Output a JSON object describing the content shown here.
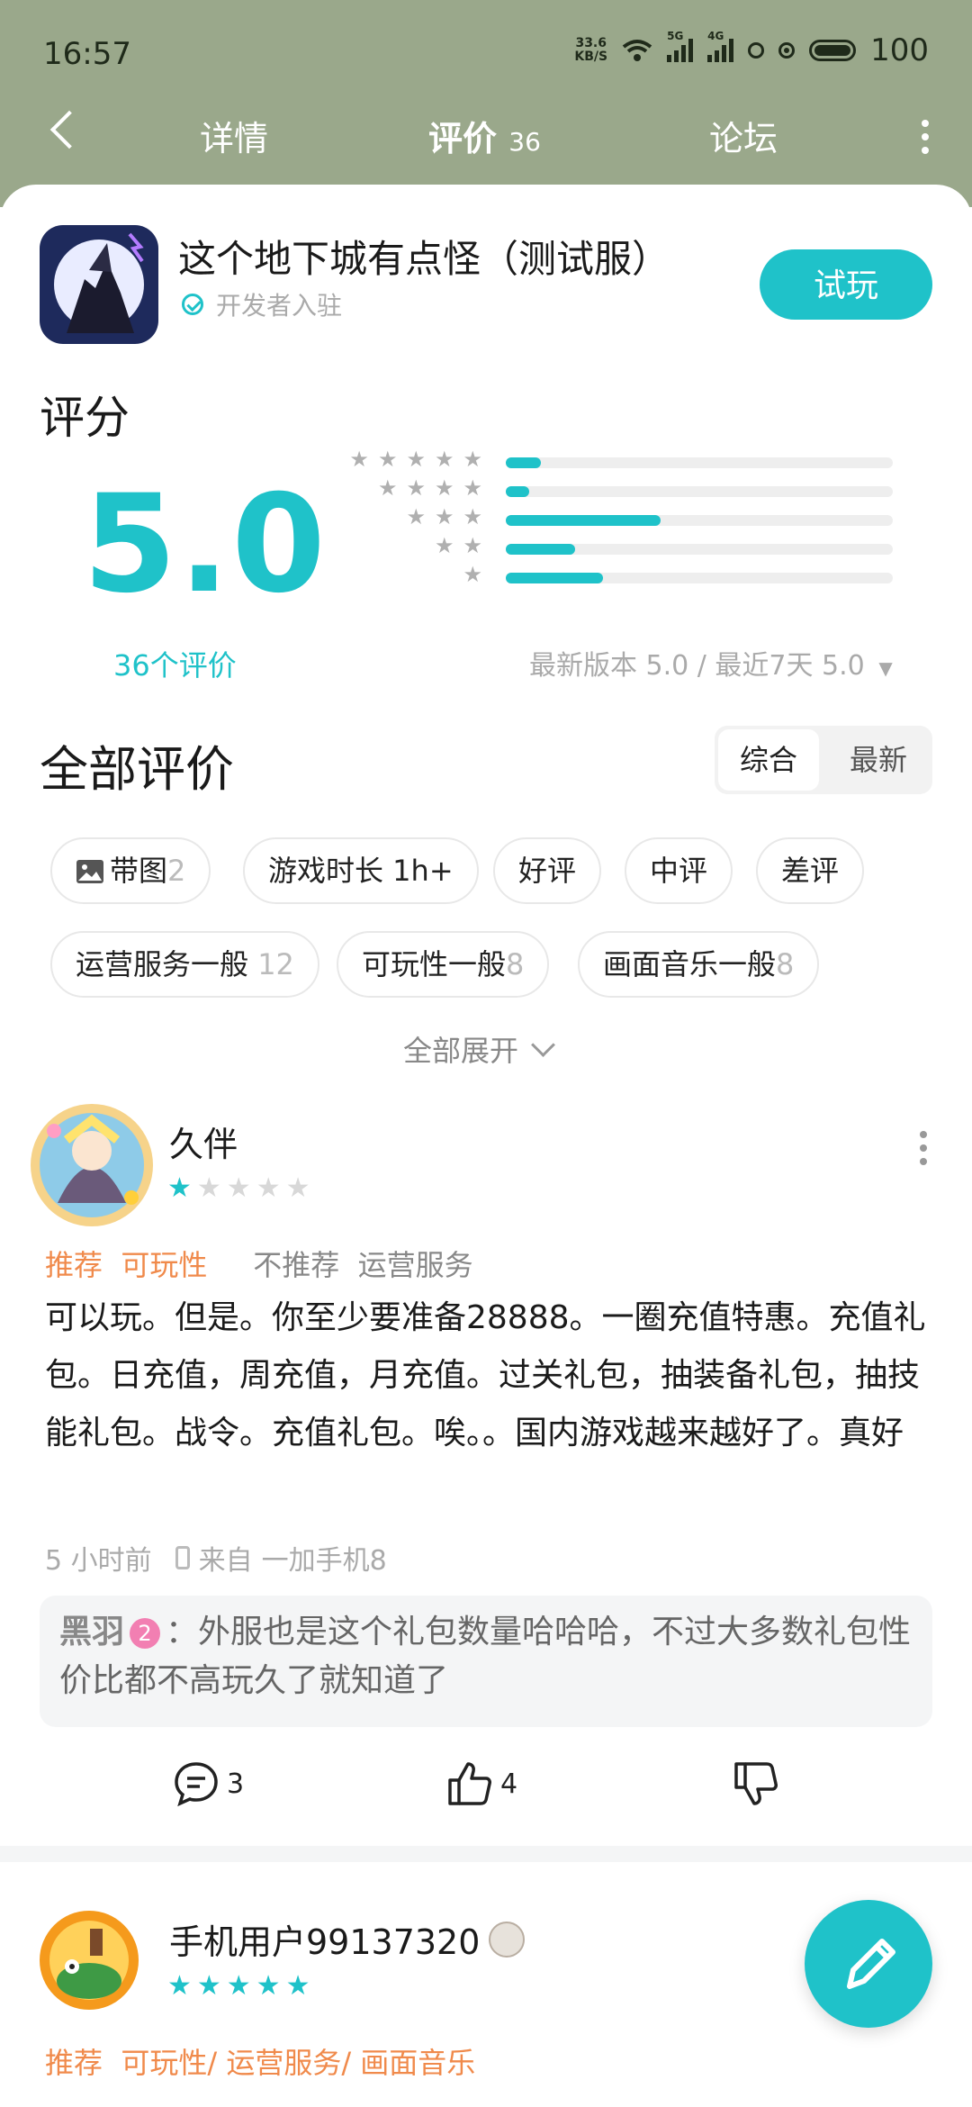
{
  "status_bar": {
    "time": "16:57",
    "net_speed_top": "33.6",
    "net_speed_bottom": "KB/S",
    "sim1": "5G",
    "sim2": "4G",
    "battery": "100"
  },
  "nav": {
    "tab_detail": "详情",
    "tab_reviews": "评价",
    "reviews_count": "36",
    "tab_forum": "论坛"
  },
  "app": {
    "title": "这个地下城有点怪（测试服）",
    "developer_label": "开发者入驻",
    "try_button": "试玩"
  },
  "rating": {
    "heading": "评分",
    "score": "5.0",
    "count_label": "36个评价",
    "version_filter": "最新版本 5.0 / 最近7天 5.0",
    "distribution": [
      {
        "stars": 5,
        "fraction": 0.09
      },
      {
        "stars": 4,
        "fraction": 0.06
      },
      {
        "stars": 3,
        "fraction": 0.4
      },
      {
        "stars": 2,
        "fraction": 0.18
      },
      {
        "stars": 1,
        "fraction": 0.25
      }
    ]
  },
  "all_reviews": {
    "heading": "全部评价",
    "sort_tabs": [
      "综合",
      "最新"
    ],
    "chips_row1": [
      {
        "label": "带图",
        "count": "2",
        "icon": "image-icon"
      },
      {
        "label": "游戏时长  1h+",
        "count": ""
      },
      {
        "label": "好评",
        "count": ""
      },
      {
        "label": "中评",
        "count": ""
      },
      {
        "label": "差评",
        "count": ""
      }
    ],
    "chips_row2": [
      {
        "label": "运营服务一般",
        "count": "12"
      },
      {
        "label": "可玩性一般",
        "count": "8"
      },
      {
        "label": "画面音乐一般",
        "count": "8"
      }
    ],
    "expand_label": "全部展开"
  },
  "reviews": [
    {
      "username": "久伴",
      "rating": 1,
      "recommend_label": "推荐",
      "recommend_tags": "可玩性",
      "not_recommend_label": "不推荐",
      "not_recommend_tags": "运营服务",
      "text": "可以玩。但是。你至少要准备28888。一圈充值特惠。充值礼包。日充值，周充值，月充值。过关礼包，抽装备礼包，抽技能礼包。战令。充值礼包。唉。。国内游戏越来越好了。真好",
      "time": "5 小时前",
      "from_label": "来自",
      "device": "一加手机8",
      "reply": {
        "name": "黑羽",
        "level": "2",
        "text": "：外服也是这个礼包数量哈哈哈，不过大多数礼包性价比都不高玩久了就知道了"
      },
      "comments": "3",
      "likes": "4"
    },
    {
      "username": "手机用户99137320",
      "rating": 5,
      "recommend_label": "推荐",
      "recommend_tags": "可玩性/ 运营服务/ 画面音乐"
    }
  ],
  "colors": {
    "accent": "#1fc2c9",
    "header_bg": "#9aa88b",
    "tag_positive": "#f08a4b"
  }
}
